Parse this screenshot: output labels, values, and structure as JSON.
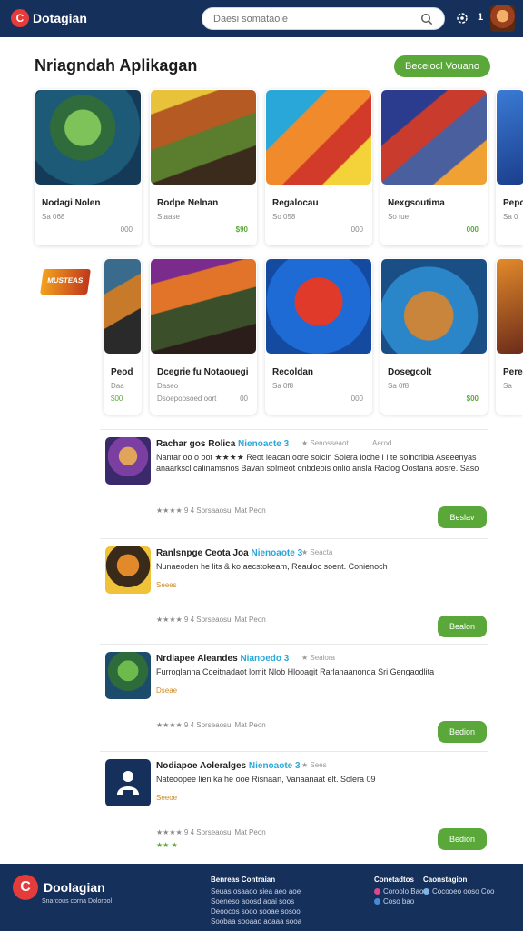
{
  "header": {
    "logo_letter": "C",
    "brand": "Dotagian",
    "search_placeholder": "Daesi somataole",
    "notif_count": "1"
  },
  "section": {
    "title": "Nriagndah Aplikagan",
    "cta": "Beceiocl Vouano"
  },
  "cards_row1": [
    {
      "name": "Nodagi Nolen",
      "sub": "Sa 068",
      "sub2": "",
      "price": "000",
      "price_color": "grey"
    },
    {
      "name": "Rodpe Nelnan",
      "sub": "Staase",
      "sub2": "",
      "price": "$90",
      "price_color": "green"
    },
    {
      "name": "Regalocau",
      "sub": "So 058",
      "sub2": "",
      "price": "000",
      "price_color": "grey"
    },
    {
      "name": "Nexgsoutima",
      "sub": "So tue",
      "sub2": "",
      "price": "000",
      "price_color": "green"
    },
    {
      "name": "Pepo",
      "sub": "Sa 0",
      "sub2": "",
      "price": "",
      "price_color": "grey"
    }
  ],
  "cards_row2": [
    {
      "name": "Peod",
      "sub": "Daa",
      "sub2": "",
      "price": "$00",
      "price_color": "green"
    },
    {
      "name": "Dcegrie fu Notaouegi",
      "sub": "Daseo",
      "sub2": "Dsoepoosoed oort",
      "price": "00",
      "price_color": "grey"
    },
    {
      "name": "Recoldan",
      "sub": "Sa 0f8",
      "sub2": "",
      "price": "000",
      "price_color": "grey"
    },
    {
      "name": "Dosegcolt",
      "sub": "Sa 0f8",
      "sub2": "",
      "price": "$00",
      "price_color": "green"
    },
    {
      "name": "Pere",
      "sub": "Sa",
      "sub2": "",
      "price": "",
      "price_color": "grey"
    }
  ],
  "side_logo": "MUSTEAS",
  "list": [
    {
      "title": "Rachar gos Rolica",
      "tag": "Nienoacte 3",
      "meta": "★ Senosseaot",
      "meta2": "Aerod",
      "desc": "Nantar oo o oot ★★★★ Reot leacan oore soicin Solera loche I i te solncribla Aseeenyas anaarkscl calinamsnos Bavan solmeot onbdeois onlio ansla Raclog Oostana aosre. Saso",
      "note": "",
      "rating": "★★★★ 9 4 Sorsaaosul Mat Peon",
      "button": "Beslav",
      "extra": ""
    },
    {
      "title": "Ranlsnpge Ceota Joa",
      "tag": "Nienoaote 3",
      "meta": "★ Seacta",
      "meta2": "",
      "desc": "Nunaeoden he lits & ko aecstokeam, Reauloc soent. Conienoch",
      "note": "Seees",
      "rating": "★★★★ 9 4 Sorseaosul Mat Peon",
      "button": "Bealon",
      "extra": ""
    },
    {
      "title": "Nrdiapee Aleandes",
      "tag": "Nianoedo 3",
      "meta": "★ Seaiora",
      "meta2": "",
      "desc": "Furroglanna Coeitnadaot lomit Nlob Hlooagit Rarlanaanonda Sri Gengaodlita",
      "note": "Dseae",
      "rating": "★★★★ 9 4 Sorseaosul Mat Peon",
      "button": "Bedion",
      "extra": ""
    },
    {
      "title": "Nodiapoe Aoleralges",
      "tag": "Nienoaote 3",
      "meta": "★ Sees",
      "meta2": "",
      "desc": "Nateoopee lien ka he ooe Risnaan, Vanaanaat elt. Solera 09",
      "note": "Seeoe",
      "rating": "★★★★ 9 4 Sorseaosul Mat Peon",
      "button": "Bedion",
      "extra": "★★ ★"
    }
  ],
  "footer": {
    "logo_letter": "C",
    "brand": "Doolagian",
    "tagline": "Snarcous corna Dolorbol",
    "col1": {
      "heading": "Benreas Contraian",
      "lines": [
        "Seuas osaaoo siea aeo aoe",
        "Soeneso aoosd aoai soos",
        "Deoocos sooo sooae sosoo",
        "Soobaa sooaao aoaaa sooa"
      ]
    },
    "col2": {
      "heading": "Conetadtos",
      "items": [
        "Coroolo Baoo",
        "Coso bao"
      ]
    },
    "col3": {
      "heading": "Caonstagion",
      "items": [
        "Cocooeo ooso Coo"
      ]
    }
  },
  "colors": {
    "navy": "#16305c",
    "green": "#5aa83a",
    "accent_red": "#e43b3b",
    "accent_blue": "#29a8d8",
    "star": "#f0a51a"
  }
}
